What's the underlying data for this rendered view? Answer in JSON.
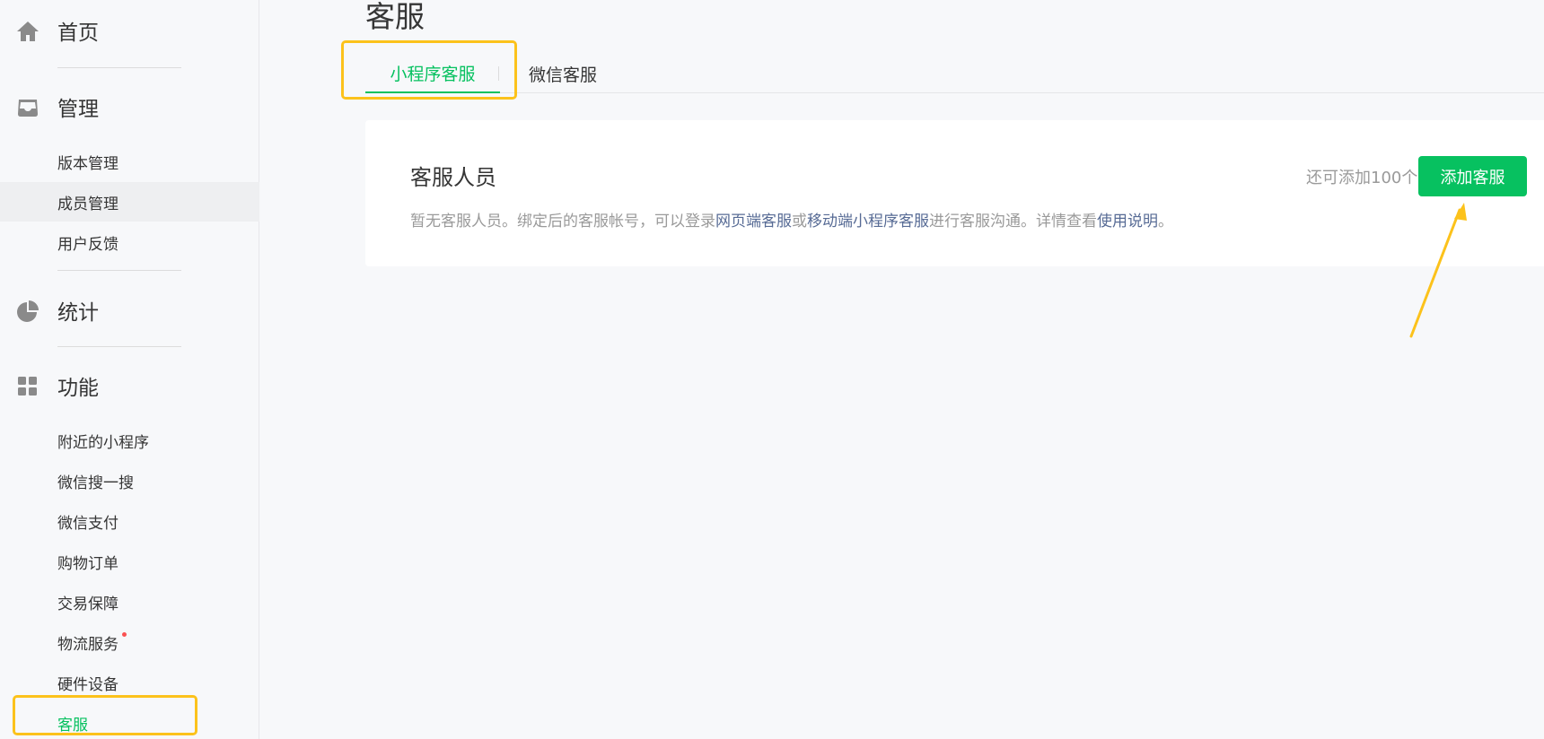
{
  "sidebar": {
    "home": {
      "label": "首页",
      "icon": "home-icon"
    },
    "manage": {
      "label": "管理",
      "icon": "inbox-icon",
      "items": [
        {
          "label": "版本管理"
        },
        {
          "label": "成员管理"
        },
        {
          "label": "用户反馈"
        }
      ]
    },
    "stats": {
      "label": "统计",
      "icon": "pie-chart-icon"
    },
    "features": {
      "label": "功能",
      "icon": "grid-icon",
      "items": [
        {
          "label": "附近的小程序"
        },
        {
          "label": "微信搜一搜"
        },
        {
          "label": "微信支付"
        },
        {
          "label": "购物订单"
        },
        {
          "label": "交易保障"
        },
        {
          "label": "物流服务"
        },
        {
          "label": "硬件设备"
        },
        {
          "label": "客服"
        }
      ]
    }
  },
  "main": {
    "title": "客服",
    "tabs": [
      {
        "label": "小程序客服"
      },
      {
        "label": "微信客服"
      }
    ],
    "card": {
      "title": "客服人员",
      "desc_prefix": "暂无客服人员。绑定后的客服帐号，可以登录",
      "link_web": "网页端客服",
      "desc_or": "或",
      "link_mobile": "移动端小程序客服",
      "desc_middle": "进行客服沟通。详情查看",
      "link_help": "使用说明",
      "desc_end": "。",
      "remain_text": "还可添加100个",
      "add_button": "添加客服"
    }
  },
  "colors": {
    "accent": "#07c160",
    "link": "#576b95",
    "highlight": "#fcc21b",
    "badge": "#fa5151"
  }
}
